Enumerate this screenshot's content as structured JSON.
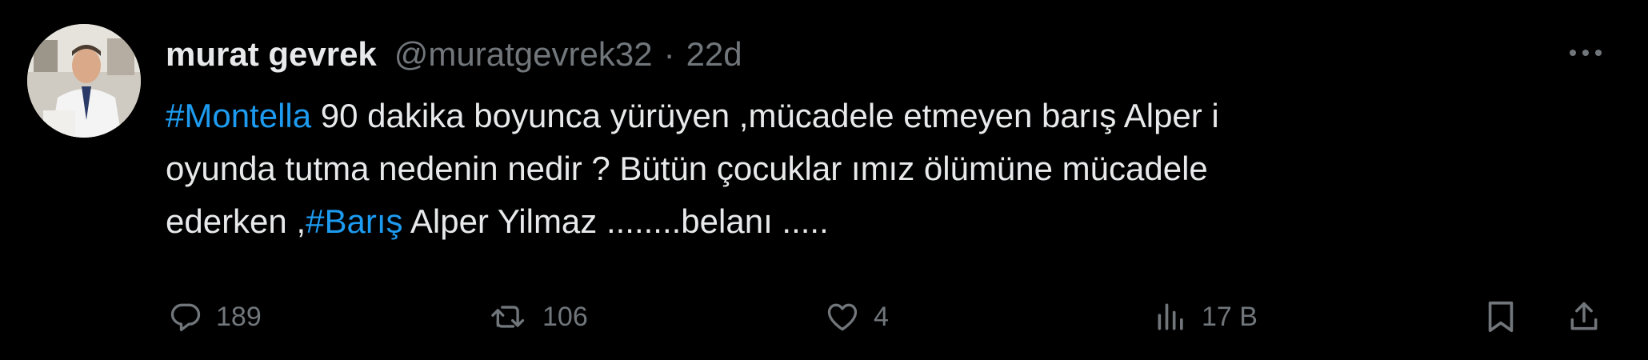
{
  "tweet": {
    "display_name": "murat gevrek",
    "handle": "@muratgevrek32",
    "separator": "·",
    "time": "22d",
    "text": {
      "line1_hashtag": "#Montella",
      "line1_rest": " 90 dakika boyunca yürüyen ,mücadele etmeyen barış Alper i",
      "line2": "oyunda tutma nedenin nedir ? Bütün çocuklar ımız ölümüne mücadele",
      "line3_start": "ederken ,",
      "line3_hashtag": "#Barış",
      "line3_rest": " Alper Yilmaz ........belanı ....."
    }
  },
  "actions": {
    "replies": "189",
    "reposts": "106",
    "likes": "4",
    "views": "17 B"
  },
  "colors": {
    "background": "#000000",
    "text": "#e7e9ea",
    "muted": "#71767b",
    "link": "#1d9bf0"
  },
  "icons": {
    "more": "more-icon",
    "reply": "reply-icon",
    "repost": "repost-icon",
    "like": "heart-icon",
    "views": "views-icon",
    "bookmark": "bookmark-icon",
    "share": "share-icon"
  }
}
